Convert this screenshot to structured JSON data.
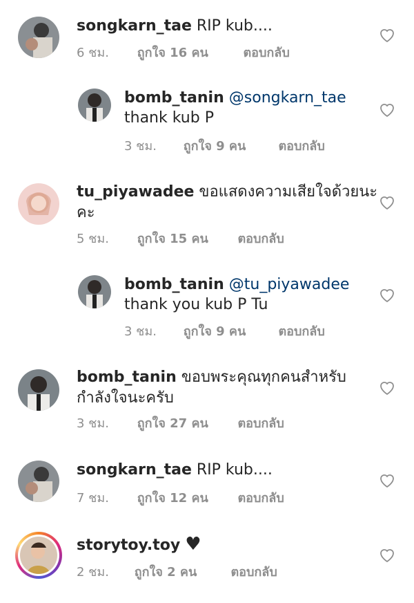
{
  "comments": [
    {
      "user": "songkarn_tae",
      "text": "RIP kub....",
      "time": "6 ชม.",
      "likes": "ถูกใจ 16 คน",
      "reply": "ตอบกลับ"
    },
    {
      "user": "bomb_tanin",
      "mention": "@songkarn_tae",
      "text": "thank kub P",
      "time": "3 ชม.",
      "likes": "ถูกใจ 9 คน",
      "reply": "ตอบกลับ"
    },
    {
      "user": "tu_piyawadee",
      "text": "ขอแสดงความเสียใจด้วยนะ",
      "text2": "คะ",
      "time": "5 ชม.",
      "likes": "ถูกใจ 15 คน",
      "reply": "ตอบกลับ"
    },
    {
      "user": "bomb_tanin",
      "mention": "@tu_piyawadee",
      "text": "thank you kub P Tu",
      "time": "3 ชม.",
      "likes": "ถูกใจ 9 คน",
      "reply": "ตอบกลับ"
    },
    {
      "user": "bomb_tanin",
      "text": "ขอบพระคุณทุกคนสำหรับ",
      "text2": "กำลังใจนะครับ",
      "time": "3 ชม.",
      "likes": "ถูกใจ 27 คน",
      "reply": "ตอบกลับ"
    },
    {
      "user": "songkarn_tae",
      "text": "RIP kub....",
      "time": "7 ชม.",
      "likes": "ถูกใจ 12 คน",
      "reply": "ตอบกลับ"
    },
    {
      "user": "storytoy.toy",
      "text": "♥",
      "time": "2 ชม.",
      "likes": "ถูกใจ 2 คน",
      "reply": "ตอบกลับ"
    }
  ],
  "colors": {
    "text": "#262626",
    "meta": "#8e8e8e",
    "mention": "#00376b"
  },
  "icons": {
    "like": "heart-outline-icon"
  }
}
